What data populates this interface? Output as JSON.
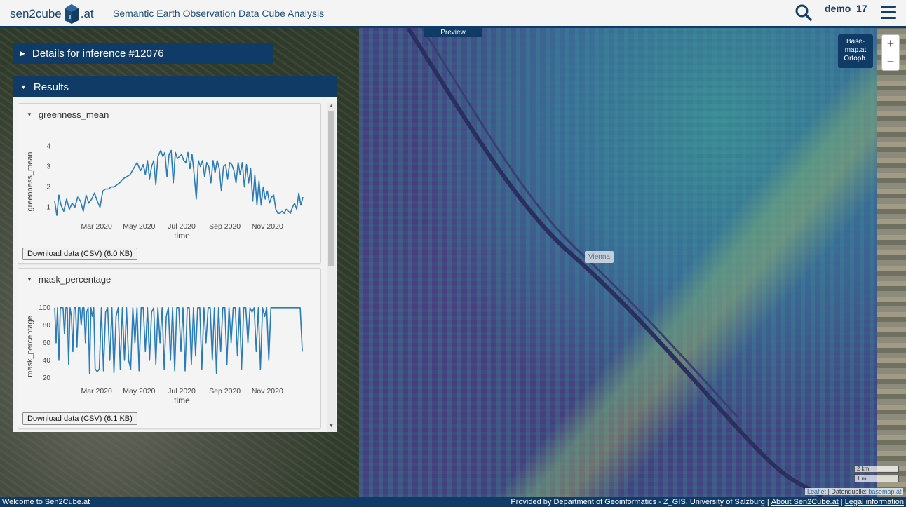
{
  "header": {
    "logo_left": "sen2cube",
    "logo_right": ".at",
    "title": "Semantic Earth Observation Data Cube Analysis",
    "user": "demo_17",
    "icons": {
      "search": "search-icon",
      "menu": "hamburger-menu-icon"
    }
  },
  "map": {
    "preview_tab": "Preview",
    "basemap_button": [
      "Base-",
      "map.at",
      "Ortoph."
    ],
    "zoom_in": "+",
    "zoom_out": "−",
    "city_label": "Vienna",
    "scale_km": "2 km",
    "scale_mi": "1 mi",
    "attribution": {
      "leaflet": "Leaflet",
      "datenquelle": " | Datenquelle: ",
      "basemap": "basemap.at"
    }
  },
  "details": {
    "title": "Details for inference #12076"
  },
  "results": {
    "title": "Results",
    "panels": [
      {
        "title": "greenness_mean",
        "download": "Download data (CSV) (6.0 KB)",
        "ylabel": "greenness_mean",
        "xlabel": "time",
        "yticks": [
          "1",
          "2",
          "3",
          "4"
        ],
        "xticks": [
          "Mar 2020",
          "May 2020",
          "Jul 2020",
          "Sep 2020",
          "Nov 2020"
        ]
      },
      {
        "title": "mask_percentage",
        "download": "Download data (CSV) (6.1 KB)",
        "ylabel": "mask_percentage",
        "xlabel": "time",
        "yticks": [
          "20",
          "40",
          "60",
          "80",
          "100"
        ],
        "xticks": [
          "Mar 2020",
          "May 2020",
          "Jul 2020",
          "Sep 2020",
          "Nov 2020"
        ]
      }
    ]
  },
  "footer": {
    "left": "Welcome to Sen2Cube.at",
    "provided": "Provided by Department of Geoinformatics - Z_GIS, University of Salzburg",
    "about": "About Sen2Cube.at",
    "legal": "Legal information",
    "divider": "|"
  },
  "colors": {
    "brand": "#0f3b66",
    "line": "#2a7bb8"
  },
  "chart_data": [
    {
      "type": "line",
      "title": "greenness_mean",
      "xlabel": "time",
      "ylabel": "greenness_mean",
      "xlim": [
        "2020-01-01",
        "2020-12-31"
      ],
      "ylim": [
        0.5,
        4.3
      ],
      "series": [
        {
          "x": [
            "2020-01-01",
            "2020-01-04",
            "2020-01-07",
            "2020-01-10",
            "2020-01-14",
            "2020-01-18",
            "2020-01-22",
            "2020-01-26",
            "2020-01-30",
            "2020-02-03",
            "2020-02-07",
            "2020-02-11",
            "2020-02-15",
            "2020-02-19",
            "2020-02-23",
            "2020-02-27",
            "2020-03-02",
            "2020-03-06",
            "2020-03-10",
            "2020-03-14",
            "2020-03-18",
            "2020-03-22",
            "2020-03-26",
            "2020-03-30",
            "2020-04-03",
            "2020-04-08",
            "2020-04-13",
            "2020-04-18",
            "2020-04-23",
            "2020-04-28",
            "2020-05-03",
            "2020-05-07",
            "2020-05-10",
            "2020-05-13",
            "2020-05-16",
            "2020-05-19",
            "2020-05-22",
            "2020-05-25",
            "2020-05-28",
            "2020-06-01",
            "2020-06-04",
            "2020-06-07",
            "2020-06-10",
            "2020-06-13",
            "2020-06-16",
            "2020-06-19",
            "2020-06-22",
            "2020-06-25",
            "2020-06-28",
            "2020-07-01",
            "2020-07-04",
            "2020-07-07",
            "2020-07-10",
            "2020-07-13",
            "2020-07-16",
            "2020-07-19",
            "2020-07-22",
            "2020-07-25",
            "2020-07-28",
            "2020-07-31",
            "2020-08-03",
            "2020-08-06",
            "2020-08-09",
            "2020-08-12",
            "2020-08-15",
            "2020-08-18",
            "2020-08-21",
            "2020-08-24",
            "2020-08-27",
            "2020-08-30",
            "2020-09-02",
            "2020-09-05",
            "2020-09-08",
            "2020-09-11",
            "2020-09-14",
            "2020-09-17",
            "2020-09-20",
            "2020-09-23",
            "2020-09-26",
            "2020-09-29",
            "2020-10-02",
            "2020-10-05",
            "2020-10-08",
            "2020-10-11",
            "2020-10-14",
            "2020-10-17",
            "2020-10-20",
            "2020-10-23",
            "2020-10-26",
            "2020-10-29",
            "2020-11-01",
            "2020-11-04",
            "2020-11-07",
            "2020-11-10",
            "2020-11-13",
            "2020-11-16",
            "2020-11-19",
            "2020-11-22",
            "2020-11-25",
            "2020-11-28",
            "2020-12-01",
            "2020-12-04",
            "2020-12-07",
            "2020-12-10",
            "2020-12-13",
            "2020-12-16",
            "2020-12-19",
            "2020-12-22"
          ],
          "y": [
            1.3,
            0.6,
            1.6,
            1.1,
            0.8,
            1.4,
            0.9,
            1.2,
            1.0,
            1.5,
            1.3,
            0.8,
            1.6,
            1.2,
            1.4,
            1.7,
            1.3,
            1.0,
            1.8,
            1.9,
            1.9,
            2.0,
            2.0,
            2.1,
            2.2,
            2.4,
            2.5,
            2.6,
            2.9,
            3.2,
            2.8,
            3.1,
            2.6,
            3.3,
            2.4,
            3.0,
            3.3,
            2.1,
            3.5,
            3.8,
            3.5,
            3.7,
            2.5,
            3.6,
            3.8,
            2.2,
            3.7,
            3.4,
            3.5,
            3.6,
            3.3,
            3.2,
            3.7,
            2.9,
            3.6,
            2.6,
            1.4,
            3.3,
            3.0,
            3.3,
            2.5,
            3.2,
            3.0,
            2.2,
            3.3,
            2.7,
            3.3,
            2.9,
            1.8,
            3.0,
            3.1,
            2.4,
            3.2,
            3.1,
            2.8,
            2.2,
            3.2,
            2.6,
            3.2,
            2.0,
            3.1,
            2.2,
            2.9,
            1.3,
            2.6,
            1.1,
            2.3,
            1.1,
            2.0,
            1.4,
            1.8,
            1.2,
            1.5,
            1.6,
            0.9,
            0.7,
            0.7,
            0.8,
            0.7,
            0.9,
            0.8,
            0.7,
            1.0,
            1.2,
            0.9,
            1.7,
            1.1,
            1.5
          ]
        }
      ]
    },
    {
      "type": "line",
      "title": "mask_percentage",
      "xlabel": "time",
      "ylabel": "mask_percentage",
      "xlim": [
        "2020-01-01",
        "2020-12-31"
      ],
      "ylim": [
        15,
        103
      ],
      "series": [
        {
          "x": [
            "2020-01-01",
            "2020-01-03",
            "2020-01-05",
            "2020-01-07",
            "2020-01-09",
            "2020-01-11",
            "2020-01-13",
            "2020-01-15",
            "2020-01-17",
            "2020-01-19",
            "2020-01-21",
            "2020-01-23",
            "2020-01-25",
            "2020-01-27",
            "2020-01-29",
            "2020-01-31",
            "2020-02-02",
            "2020-02-04",
            "2020-02-06",
            "2020-02-08",
            "2020-02-10",
            "2020-02-12",
            "2020-02-14",
            "2020-02-16",
            "2020-02-18",
            "2020-02-20",
            "2020-02-22",
            "2020-02-24",
            "2020-02-26",
            "2020-02-28",
            "2020-03-02",
            "2020-03-05",
            "2020-03-08",
            "2020-03-11",
            "2020-03-14",
            "2020-03-17",
            "2020-03-20",
            "2020-03-23",
            "2020-03-26",
            "2020-03-29",
            "2020-04-01",
            "2020-04-04",
            "2020-04-07",
            "2020-04-10",
            "2020-04-13",
            "2020-04-16",
            "2020-04-19",
            "2020-04-22",
            "2020-04-25",
            "2020-04-28",
            "2020-05-01",
            "2020-05-04",
            "2020-05-07",
            "2020-05-10",
            "2020-05-13",
            "2020-05-16",
            "2020-05-19",
            "2020-05-22",
            "2020-05-25",
            "2020-05-28",
            "2020-05-31",
            "2020-06-03",
            "2020-06-06",
            "2020-06-09",
            "2020-06-12",
            "2020-06-15",
            "2020-06-18",
            "2020-06-21",
            "2020-06-24",
            "2020-06-27",
            "2020-06-30",
            "2020-07-03",
            "2020-07-06",
            "2020-07-09",
            "2020-07-12",
            "2020-07-15",
            "2020-07-18",
            "2020-07-21",
            "2020-07-24",
            "2020-07-27",
            "2020-07-30",
            "2020-08-02",
            "2020-08-05",
            "2020-08-08",
            "2020-08-11",
            "2020-08-14",
            "2020-08-17",
            "2020-08-20",
            "2020-08-23",
            "2020-08-26",
            "2020-08-29",
            "2020-09-01",
            "2020-09-04",
            "2020-09-07",
            "2020-09-10",
            "2020-09-13",
            "2020-09-16",
            "2020-09-19",
            "2020-09-22",
            "2020-09-25",
            "2020-09-28",
            "2020-10-01",
            "2020-10-04",
            "2020-10-07",
            "2020-10-10",
            "2020-10-13",
            "2020-10-16",
            "2020-10-19",
            "2020-10-22",
            "2020-10-25",
            "2020-10-28",
            "2020-10-31",
            "2020-11-03",
            "2020-11-06",
            "2020-11-09",
            "2020-11-12",
            "2020-11-15",
            "2020-11-18",
            "2020-11-21",
            "2020-11-24",
            "2020-11-27",
            "2020-11-30",
            "2020-12-03",
            "2020-12-06",
            "2020-12-09",
            "2020-12-12",
            "2020-12-15",
            "2020-12-18",
            "2020-12-21"
          ],
          "y": [
            100,
            60,
            100,
            40,
            100,
            100,
            100,
            70,
            100,
            100,
            35,
            100,
            90,
            50,
            100,
            100,
            55,
            100,
            100,
            80,
            100,
            100,
            60,
            95,
            100,
            25,
            100,
            90,
            100,
            30,
            27,
            30,
            100,
            28,
            95,
            100,
            40,
            100,
            26,
            90,
            100,
            30,
            100,
            40,
            100,
            40,
            30,
            100,
            60,
            100,
            28,
            100,
            100,
            50,
            100,
            40,
            95,
            100,
            35,
            100,
            60,
            100,
            30,
            90,
            100,
            40,
            100,
            28,
            100,
            100,
            50,
            100,
            28,
            100,
            100,
            35,
            100,
            45,
            100,
            100,
            30,
            100,
            60,
            100,
            100,
            40,
            100,
            25,
            100,
            50,
            100,
            100,
            35,
            100,
            60,
            100,
            100,
            45,
            100,
            30,
            100,
            100,
            60,
            100,
            95,
            100,
            50,
            100,
            30,
            100,
            90,
            100,
            40,
            100,
            100,
            100,
            100,
            100,
            100,
            100,
            100,
            100,
            100,
            100,
            100,
            100,
            100,
            100,
            50
          ]
        }
      ]
    }
  ]
}
